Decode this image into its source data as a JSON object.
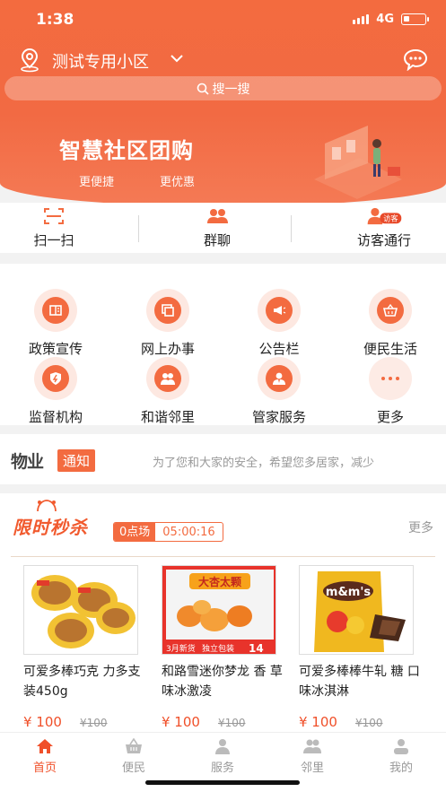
{
  "status_bar": {
    "time": "1:38",
    "network": "4G",
    "battery_level": 0.3
  },
  "header": {
    "community_name": "测试专用小区",
    "search_placeholder": "搜一搜",
    "banner_title": "智慧社区团购",
    "banner_sub1": "更便捷",
    "banner_sub2": "更优惠",
    "visitor_badge": "访客"
  },
  "quick_actions": [
    {
      "label": "扫一扫",
      "icon": "scan-icon"
    },
    {
      "label": "群聊",
      "icon": "group-chat-icon"
    },
    {
      "label": "访客通行",
      "icon": "visitor-icon"
    }
  ],
  "services": [
    {
      "label": "政策宣传",
      "icon": "policy-icon"
    },
    {
      "label": "网上办事",
      "icon": "online-service-icon"
    },
    {
      "label": "公告栏",
      "icon": "megaphone-icon"
    },
    {
      "label": "便民生活",
      "icon": "basket-icon"
    },
    {
      "label": "监督机构",
      "icon": "shield-icon"
    },
    {
      "label": "和谐邻里",
      "icon": "neighbors-icon"
    },
    {
      "label": "管家服务",
      "icon": "butler-icon"
    },
    {
      "label": "更多",
      "icon": "more-icon"
    }
  ],
  "notice": {
    "prefix": "物业",
    "tag": "通知",
    "text": "为了您和大家的安全，希望您多居家，减少"
  },
  "flash_sale": {
    "title": "限时秒杀",
    "session_name": "0点场",
    "countdown": "05:00:16",
    "more_label": "更多",
    "products": [
      {
        "name": "可爱多棒巧克 力多支装450g",
        "price": "¥ 100",
        "original_price": "¥100"
      },
      {
        "name": "和路雪迷你梦龙 香 草味冰激凌",
        "price": "¥ 100",
        "original_price": "¥100",
        "image_texts": [
          "大杏太颗",
          "3月新货",
          "独立包装",
          "14"
        ]
      },
      {
        "name": "可爱多棒棒牛轧 糖 口味冰淇淋",
        "price": "¥ 100",
        "original_price": "¥100",
        "image_texts": [
          "m&m's"
        ]
      }
    ]
  },
  "tabbar": [
    {
      "label": "首页",
      "icon": "home-icon",
      "active": true
    },
    {
      "label": "便民",
      "icon": "basket-icon"
    },
    {
      "label": "服务",
      "icon": "service-icon"
    },
    {
      "label": "邻里",
      "icon": "neighbors-icon"
    },
    {
      "label": "我的",
      "icon": "profile-icon"
    }
  ],
  "colors": {
    "primary": "#f36b40",
    "price": "#f0502a",
    "icon_bg": "#fde8e1"
  }
}
